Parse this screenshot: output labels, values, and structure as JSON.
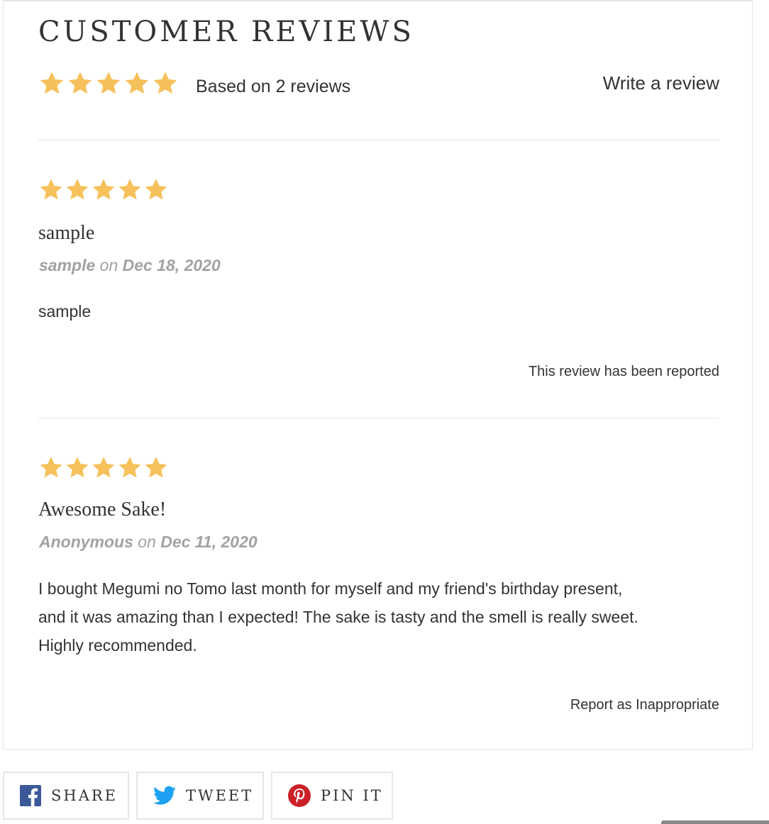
{
  "header": {
    "title": "CUSTOMER REVIEWS",
    "based_on": "Based on 2 reviews",
    "write_review": "Write a review",
    "average_rating": 5,
    "star_color": "#f6c15b"
  },
  "reviews": [
    {
      "rating": 5,
      "title": "sample",
      "author": "sample",
      "on": "on",
      "date": "Dec 18, 2020",
      "body": "sample",
      "report": "This review has been reported"
    },
    {
      "rating": 5,
      "title": "Awesome Sake!",
      "author": "Anonymous",
      "on": "on",
      "date": "Dec 11, 2020",
      "body_lines": [
        "I bought Megumi no Tomo last month for myself and my friend's birthday present,",
        "and it was amazing than I expected! The sake is tasty and the smell is really sweet.",
        "Highly recommended."
      ],
      "report": "Report as Inappropriate"
    }
  ],
  "share": {
    "facebook": {
      "label": "SHARE",
      "icon": "facebook-icon",
      "color": "#3b5998"
    },
    "twitter": {
      "label": "TWEET",
      "icon": "twitter-icon",
      "color": "#1da1f2"
    },
    "pinterest": {
      "label": "PIN IT",
      "icon": "pinterest-icon",
      "color": "#cb2027"
    }
  }
}
